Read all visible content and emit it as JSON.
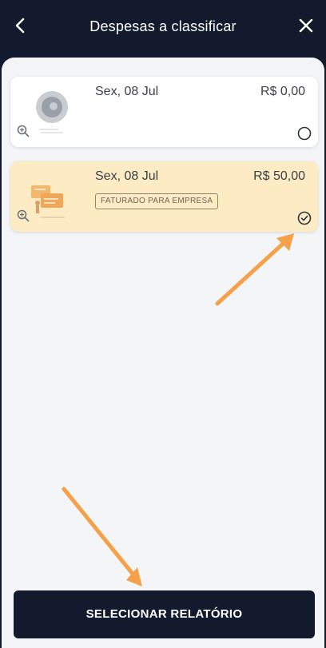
{
  "header": {
    "title": "Despesas a classificar"
  },
  "expenses": [
    {
      "date": "Sex, 08 Jul",
      "amount": "R$ 0,00",
      "badge": "",
      "selected": false
    },
    {
      "date": "Sex, 08 Jul",
      "amount": "R$ 50,00",
      "badge": "FATURADO PARA EMPRESA",
      "selected": true
    }
  ],
  "footer": {
    "button_label": "SELECIONAR RELATÓRIO"
  },
  "colors": {
    "header_bg": "#131a2e",
    "selected_card_bg": "#fcebc3",
    "annotation_arrow": "#f5a04a"
  }
}
